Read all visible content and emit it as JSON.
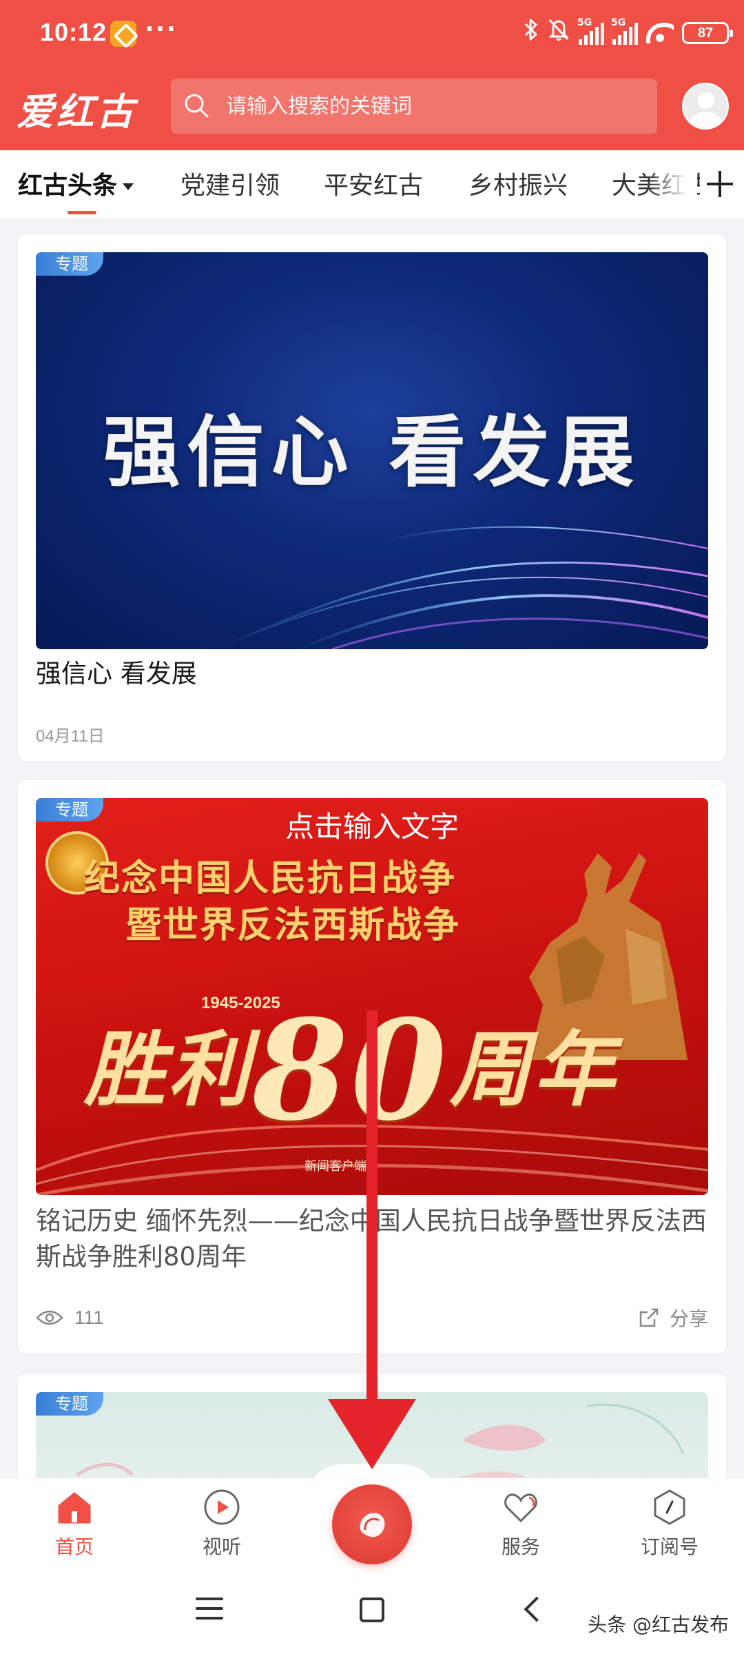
{
  "status_bar": {
    "time": "10:12",
    "dots": "···",
    "signal_labels": [
      "5G",
      "5G"
    ],
    "battery": "87"
  },
  "app": {
    "logo": "爱红古",
    "search_placeholder": "请输入搜索的关键词",
    "accent_color": "#ef4f44"
  },
  "tabs": [
    {
      "label": "红古头条",
      "active": true
    },
    {
      "label": "党建引领"
    },
    {
      "label": "平安红古"
    },
    {
      "label": "乡村振兴"
    },
    {
      "label": "大美红古"
    }
  ],
  "cards": [
    {
      "tag": "专题",
      "banner_text": "强信心  看发展",
      "title": "强信心  看发展",
      "date": "04月11日"
    },
    {
      "tag": "专题",
      "banner_top": "点击输入文字",
      "banner_line1": "纪念中国人民抗日战争",
      "banner_line2": "暨世界反法西斯战争",
      "banner_years": "1945-2025",
      "banner_victory_pre": "胜利",
      "banner_victory_num": "80",
      "banner_victory_post": "周年",
      "banner_source": "新闻客户端",
      "title": "铭记历史  缅怀先烈——纪念中国人民抗日战争暨世界反法西斯战争胜利80周年",
      "views": "111",
      "share": "分享"
    },
    {
      "tag": "专题"
    }
  ],
  "bottom_nav": [
    {
      "label": "首页",
      "icon": "home-icon",
      "active": true
    },
    {
      "label": "视听",
      "icon": "play-icon"
    },
    {
      "label": "服务",
      "icon": "heart-icon"
    },
    {
      "label": "订阅号",
      "icon": "compass-icon"
    }
  ],
  "watermark": "头条 @红古发布"
}
